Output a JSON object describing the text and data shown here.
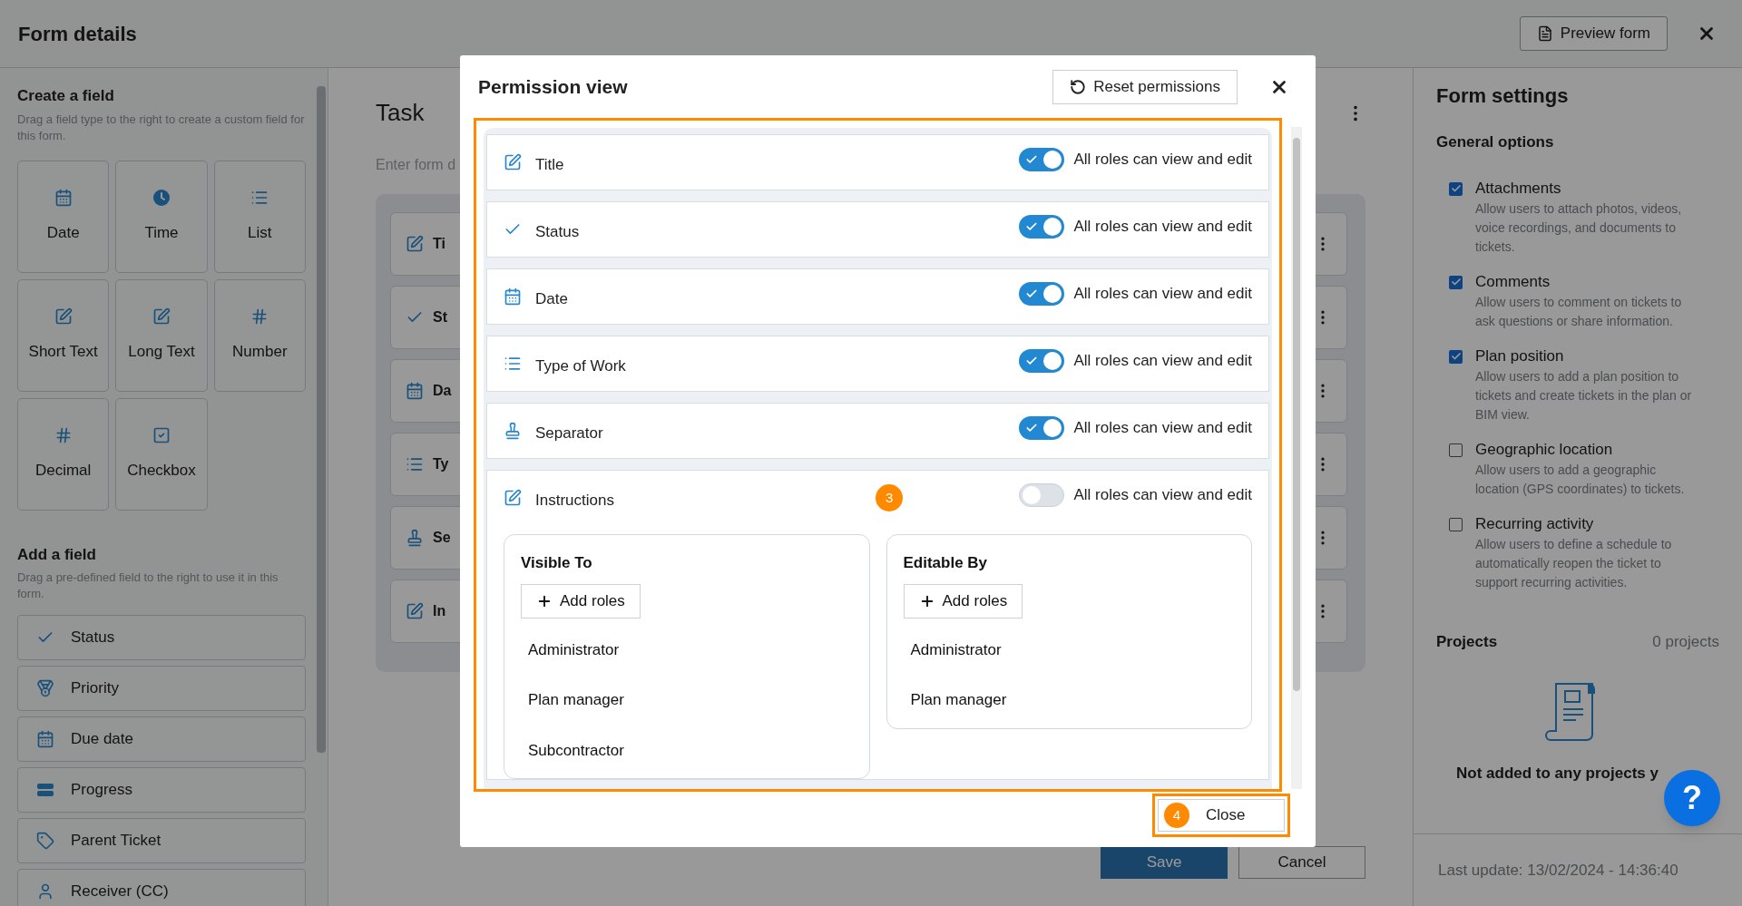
{
  "header": {
    "title": "Form details",
    "preview_button": "Preview form"
  },
  "create_field": {
    "title": "Create a field",
    "hint": "Drag a field type to the right to create a custom field for this form.",
    "types": [
      {
        "label": "Date",
        "kind": "date"
      },
      {
        "label": "Time",
        "kind": "time"
      },
      {
        "label": "List",
        "kind": "list"
      },
      {
        "label": "Short Text",
        "kind": "text"
      },
      {
        "label": "Long Text",
        "kind": "text"
      },
      {
        "label": "Number",
        "kind": "number"
      },
      {
        "label": "Decimal",
        "kind": "number"
      },
      {
        "label": "Checkbox",
        "kind": "checkbox"
      }
    ]
  },
  "add_field": {
    "title": "Add a field",
    "hint": "Drag a pre-defined field to the right to use it in this form.",
    "items": [
      {
        "label": "Status",
        "kind": "status"
      },
      {
        "label": "Priority",
        "kind": "priority"
      },
      {
        "label": "Due date",
        "kind": "date"
      },
      {
        "label": "Progress",
        "kind": "progress"
      },
      {
        "label": "Parent Ticket",
        "kind": "tag"
      },
      {
        "label": "Receiver (CC)",
        "kind": "person"
      }
    ]
  },
  "form": {
    "title": "Task",
    "description_placeholder": "Enter form d",
    "fields": [
      {
        "label": "Ti",
        "kind": "text"
      },
      {
        "label": "St",
        "kind": "status"
      },
      {
        "label": "Da",
        "kind": "date"
      },
      {
        "label": "Ty",
        "kind": "list"
      },
      {
        "label": "Se",
        "kind": "separator"
      },
      {
        "label": "In",
        "kind": "text"
      }
    ],
    "save_button": "Save",
    "cancel_button": "Cancel"
  },
  "form_settings": {
    "title": "Form settings",
    "general_title": "General options",
    "options": [
      {
        "label": "Attachments",
        "description": "Allow users to attach photos, videos, voice recordings, and documents to tickets.",
        "checked": true
      },
      {
        "label": "Comments",
        "description": "Allow users to comment on tickets to ask questions or share information.",
        "checked": true
      },
      {
        "label": "Plan position",
        "description": "Allow users to add a plan position to tickets and create tickets in the plan or BIM view.",
        "checked": true
      },
      {
        "label": "Geographic location",
        "description": "Allow users to add a geographic location (GPS coordinates) to tickets.",
        "checked": false
      },
      {
        "label": "Recurring activity",
        "description": "Allow users to define a schedule to automatically reopen the ticket to support recurring activities.",
        "checked": false
      }
    ],
    "projects_title": "Projects",
    "projects_count": "0 projects",
    "projects_empty": "Not added to any projects y",
    "last_update": "Last update: 13/02/2024 - 14:36:40"
  },
  "help_button": "?",
  "permission_view": {
    "title": "Permission view",
    "reset_button": "Reset permissions",
    "fields": [
      {
        "label": "Title",
        "kind": "text",
        "on": true,
        "toggle_label": "All roles can view and edit"
      },
      {
        "label": "Status",
        "kind": "status",
        "on": true,
        "toggle_label": "All roles can view and edit"
      },
      {
        "label": "Date",
        "kind": "date",
        "on": true,
        "toggle_label": "All roles can view and edit"
      },
      {
        "label": "Type of Work",
        "kind": "list",
        "on": true,
        "toggle_label": "All roles can view and edit"
      },
      {
        "label": "Separator",
        "kind": "separator",
        "on": true,
        "toggle_label": "All roles can view and edit"
      },
      {
        "label": "Instructions",
        "kind": "text",
        "on": false,
        "toggle_label": "All roles can view and edit",
        "badge": "3",
        "visible_to": {
          "title": "Visible To",
          "add_button": "Add roles",
          "roles": [
            "Administrator",
            "Plan manager",
            "Subcontractor"
          ]
        },
        "editable_by": {
          "title": "Editable By",
          "add_button": "Add roles",
          "roles": [
            "Administrator",
            "Plan manager"
          ]
        }
      }
    ],
    "close_badge": "4",
    "close_button": "Close"
  }
}
